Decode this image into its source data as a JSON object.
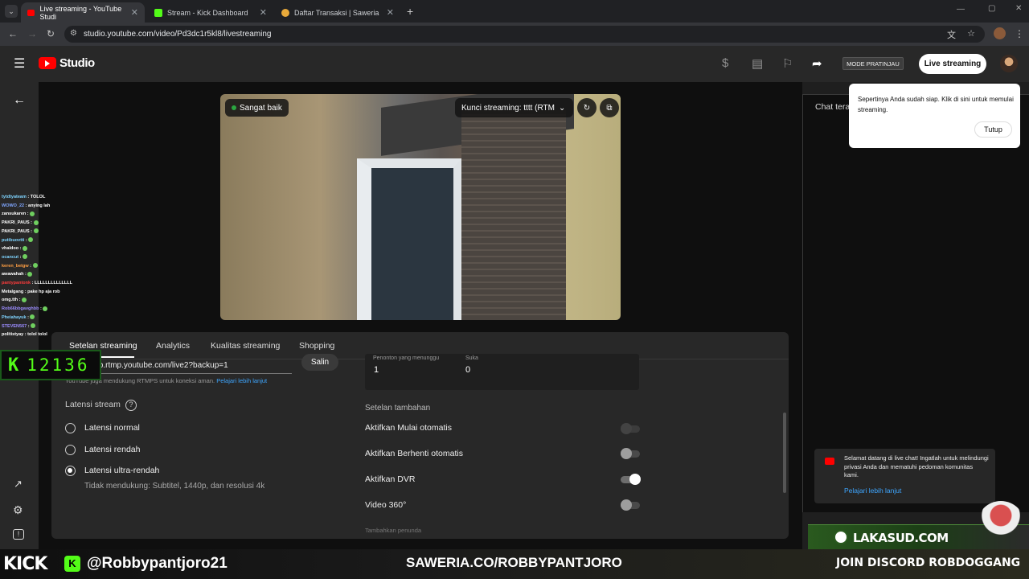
{
  "browser": {
    "tabs": [
      {
        "title": "Live streaming - YouTube Studi",
        "active": true
      },
      {
        "title": "Stream - Kick Dashboard",
        "active": false
      },
      {
        "title": "Daftar Transaksi | Saweria",
        "active": false
      }
    ],
    "url": "studio.youtube.com/video/Pd3dc1r5kl8/livestreaming"
  },
  "header": {
    "logo": "Studio",
    "mode_button": "MODE PRATINJAU",
    "live_button": "Live streaming"
  },
  "preview": {
    "status": "Sangat baik",
    "stream_key": "Kunci streaming: tttt (RTMI"
  },
  "popup": {
    "text": "Sepertinya Anda sudah siap. Klik di sini untuk memulai streaming.",
    "close": "Tutup"
  },
  "chat": {
    "title": "Chat tera"
  },
  "panel": {
    "tabs": [
      "Setelan streaming",
      "Analytics",
      "Kualitas streaming",
      "Shopping"
    ],
    "backup_url": "/b.rtmp.youtube.com/live2?backup=1",
    "copy_button": "Salin",
    "rtmps_note": "YouTube juga mendukung RTMPS untuk koneksi aman.",
    "rtmps_link": "Pelajari lebih lanjut",
    "viewers_label": "Penonton yang menunggu",
    "viewers_value": "1",
    "likes_label": "Suka",
    "likes_value": "0",
    "latency_title": "Latensi stream",
    "latency_options": [
      "Latensi normal",
      "Latensi rendah",
      "Latensi ultra-rendah"
    ],
    "latency_selected": 2,
    "latency_note": "Tidak mendukung: Subtitel, 1440p, dan resolusi 4k",
    "extra_title": "Setelan tambahan",
    "toggles": [
      {
        "label": "Aktifkan Mulai otomatis",
        "on": false
      },
      {
        "label": "Aktifkan Berhenti otomatis",
        "on": false
      },
      {
        "label": "Aktifkan DVR",
        "on": true
      },
      {
        "label": "Video 360°",
        "on": false
      }
    ],
    "footer_hint": "Tambahkan penunda"
  },
  "welcome": {
    "text": "Selamat datang di live chat! Ingatlah untuk melindungi privasi Anda dan mematuhi pedoman komunitas kami.",
    "link": "Pelajari lebih lanjut"
  },
  "overlay": {
    "kick_logo": "K",
    "kick_count": "12136",
    "chat_lines": [
      {
        "user": "tytdtyateam",
        "msg": "TOLOL",
        "color": "#7fd4ff"
      },
      {
        "user": "WOWO_22",
        "msg": "anying lah",
        "color": "#7fa6ff"
      },
      {
        "user": "zansukaren",
        "msg": "",
        "color": "#ffffff"
      },
      {
        "user": "PAKRI_PAUS",
        "msg": "",
        "color": "#ffffff"
      },
      {
        "user": "PAKRI_PAUS",
        "msg": "",
        "color": "#ffffff"
      },
      {
        "user": "putibuovtti",
        "msg": "",
        "color": "#7fd4ff"
      },
      {
        "user": "vhaldoo",
        "msg": "",
        "color": "#ffffff"
      },
      {
        "user": "ocancut",
        "msg": "",
        "color": "#7fd4ff"
      },
      {
        "user": "keren_betgw",
        "msg": "",
        "color": "#ff9f43"
      },
      {
        "user": "awawahah",
        "msg": "",
        "color": "#ffffff"
      },
      {
        "user": "pantypantonk",
        "msg": "LLLLLLLLLLLLLL",
        "color": "#ff3b3b"
      },
      {
        "user": "Metalgang",
        "msg": "pake hp aja rob",
        "color": "#ffffff"
      },
      {
        "user": "omg.tth",
        "msg": "",
        "color": "#ffffff"
      },
      {
        "user": "Rob66bbgavghbb",
        "msg": "",
        "color": "#9b8cff"
      },
      {
        "user": "Pheiahayuk",
        "msg": "",
        "color": "#7fd4ff"
      },
      {
        "user": "STEVEN567",
        "msg": "",
        "color": "#9b8cff"
      },
      {
        "user": "politistyay",
        "msg": "tolol tolol",
        "color": "#ffffff"
      }
    ],
    "kick_brand": "KICK",
    "kick_handle": "@Robbypantjoro21",
    "saweria": "SAWERIA.CO/ROBBYPANTJORO",
    "discord": "JOIN DISCORD ROBDOGGANG",
    "lakasud": "LAKASUD.COM"
  },
  "colors": {
    "accent_blue": "#3ea6ff",
    "kick_green": "#53fc18",
    "yt_red": "#ff0000"
  }
}
